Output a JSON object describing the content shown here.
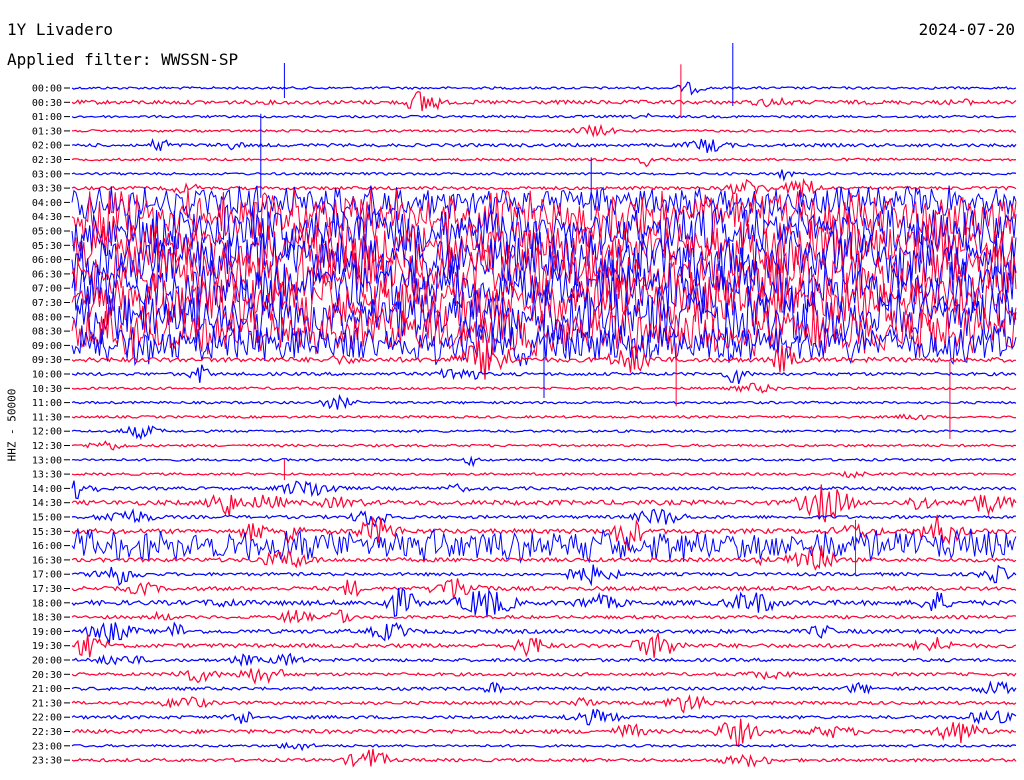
{
  "header": {
    "station": "1Y Livadero",
    "date": "2024-07-20",
    "filter": "Applied filter: WWSSN-SP"
  },
  "y_axis_label": "HHZ - 50000",
  "colors": {
    "blue": "#0000ff",
    "red": "#ff0033"
  },
  "chart_data": {
    "type": "line",
    "title": "1Y Livadero",
    "subtitle": "Applied filter: WWSSN-SP",
    "ylabel": "HHZ - 50000",
    "row_labels": [
      "00:00",
      "00:30",
      "01:00",
      "01:30",
      "02:00",
      "02:30",
      "03:00",
      "03:30",
      "04:00",
      "04:30",
      "05:00",
      "05:30",
      "06:00",
      "06:30",
      "07:00",
      "07:30",
      "08:00",
      "08:30",
      "09:00",
      "09:30",
      "10:00",
      "10:30",
      "11:00",
      "11:30",
      "12:00",
      "12:30",
      "13:00",
      "13:30",
      "14:00",
      "14:30",
      "15:00",
      "15:30",
      "16:00",
      "16:30",
      "17:00",
      "17:30",
      "18:00",
      "18:30",
      "19:00",
      "19:30",
      "20:00",
      "20:30",
      "21:00",
      "21:30",
      "22:00",
      "22:30",
      "23:00",
      "23:30"
    ],
    "row_colors": [
      "blue",
      "red"
    ],
    "series_note": "helicorder trace, alternating blue/red per 30-minute row",
    "activity": [
      1,
      3,
      1,
      1,
      2,
      1,
      1,
      2,
      5,
      8,
      8,
      9,
      9,
      9,
      9,
      9,
      9,
      8,
      6,
      4,
      2,
      1,
      1,
      1,
      1,
      1,
      1,
      1,
      2,
      4,
      2,
      4,
      5,
      3,
      2,
      3,
      4,
      2,
      3,
      3,
      2,
      2,
      2,
      2,
      2,
      3,
      1,
      2
    ],
    "spikes": [
      {
        "row": 0,
        "x": 0.225,
        "up": 25
      },
      {
        "row": 0,
        "x": 0.7,
        "up": 45
      },
      {
        "row": 1,
        "x": 0.645,
        "up": 38
      },
      {
        "row": 6,
        "x": 0.2,
        "up": 60
      },
      {
        "row": 8,
        "x": 0.55,
        "up": 45
      },
      {
        "row": 20,
        "x": 0.5,
        "up": 60
      },
      {
        "row": 21,
        "x": 0.64,
        "up": 45
      },
      {
        "row": 23,
        "x": 0.93,
        "up": 55
      },
      {
        "row": 27,
        "x": 0.225,
        "up": 15
      },
      {
        "row": 33,
        "x": 0.83,
        "up": 40
      }
    ]
  }
}
